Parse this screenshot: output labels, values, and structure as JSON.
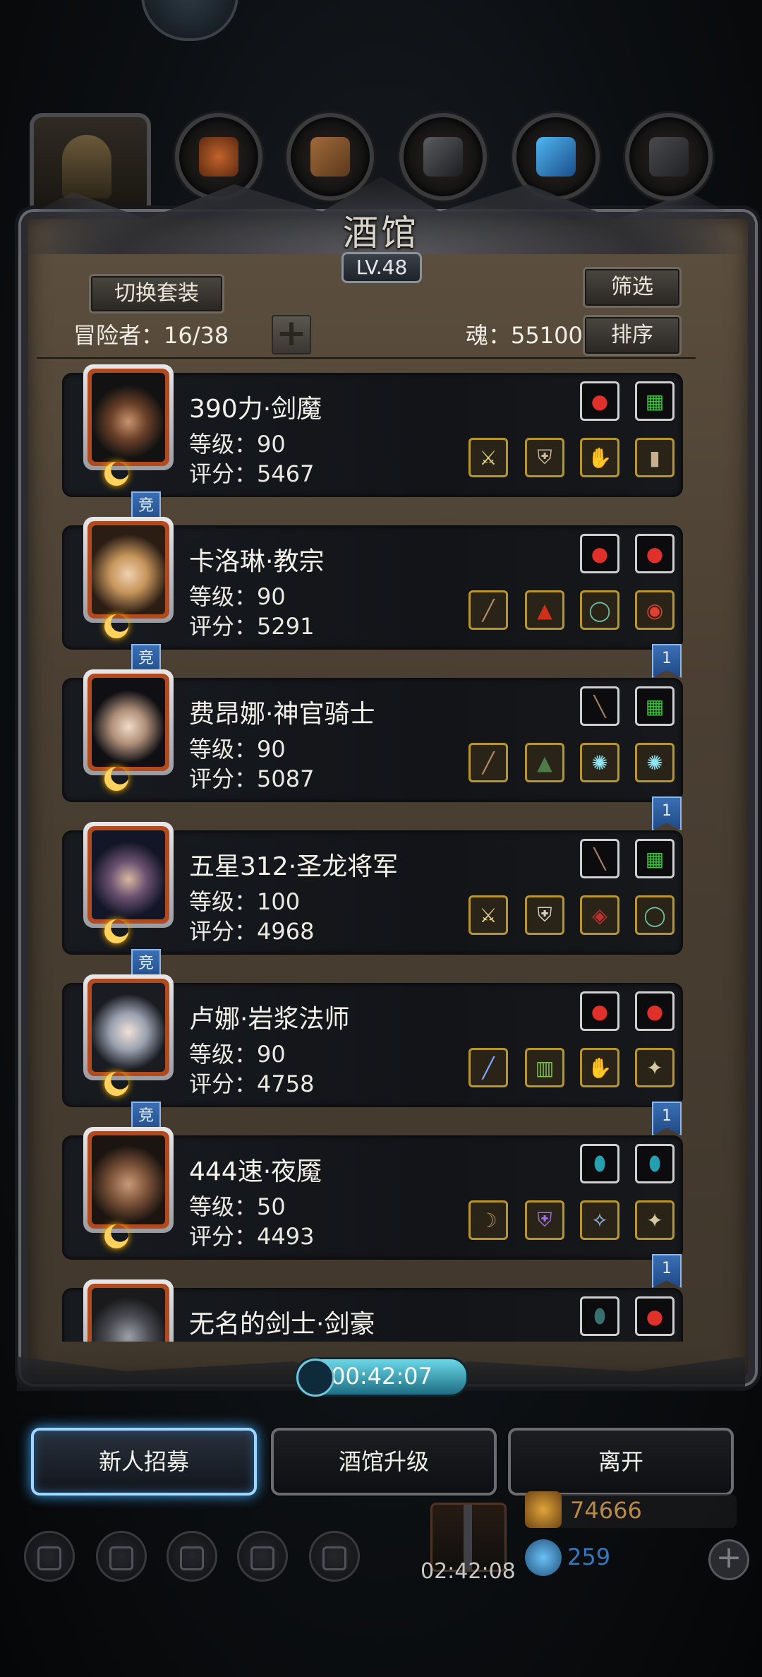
{
  "header": {
    "title": "酒馆",
    "level_badge": "LV.48",
    "tabs": [
      "helmet-icon",
      "gloves-icon",
      "wood-icon",
      "ore-icon",
      "feather-icon",
      "stone-icon"
    ]
  },
  "toolbar": {
    "switch_set_label": "切换套装",
    "filter_label": "筛选",
    "sort_label": "排序",
    "adventurers_label": "冒险者：16/38",
    "add_label": "+",
    "soul_label": "魂：55100"
  },
  "heroes": [
    {
      "name": "390力·剑魔",
      "level": "等级：90",
      "score": "评分：5467",
      "bookmark": "竞",
      "bookmark_side": "left"
    },
    {
      "name": "卡洛琳·教宗",
      "level": "等级：90",
      "score": "评分：5291",
      "bookmark": "竞",
      "bookmark_side": "left",
      "bookmark2": "1"
    },
    {
      "name": "费昂娜·神官骑士",
      "level": "等级：90",
      "score": "评分：5087",
      "bookmark2": "1"
    },
    {
      "name": "五星312·圣龙将军",
      "level": "等级：100",
      "score": "评分：4968",
      "bookmark": "竞"
    },
    {
      "name": "卢娜·岩浆法师",
      "level": "等级：90",
      "score": "评分：4758",
      "bookmark": "竞",
      "bookmark2": "1"
    },
    {
      "name": "444速·夜魇",
      "level": "等级：50",
      "score": "评分：4493",
      "bookmark2": "1"
    },
    {
      "name": "无名的剑士·剑豪",
      "level": "",
      "score": ""
    }
  ],
  "footer": {
    "timer": "00:42:07",
    "recruit_label": "新人招募",
    "upgrade_label": "酒馆升级",
    "leave_label": "离开",
    "gift_timer": "02:42:08",
    "gold": "74666",
    "gems": "259",
    "plus": "+"
  },
  "colors": {
    "panel": "#4a3f32",
    "card": "#15171b",
    "portrait_frame": "#b34a1e",
    "bookmark": "#2e5c9e",
    "timer": "#4fc3da",
    "recruit_glow": "#3aa2f0"
  }
}
